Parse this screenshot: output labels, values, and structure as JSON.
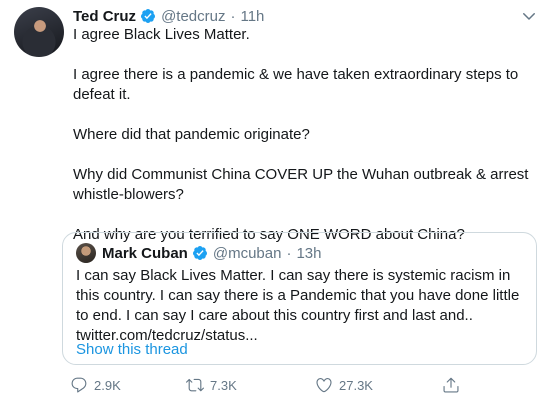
{
  "tweet": {
    "author_name": "Ted Cruz",
    "handle": "@tedcruz",
    "separator": "·",
    "time": "11h",
    "body": [
      "I agree Black Lives Matter.",
      "I agree there is a pandemic & we have taken extraordinary steps to defeat it.",
      "Where did that pandemic originate?",
      "Why did Communist China COVER UP the Wuhan outbreak & arrest whistle-blowers?",
      "And why are you terrified to say ONE WORD about China?"
    ]
  },
  "quoted_tweet": {
    "author_name": "Mark Cuban",
    "handle": "@mcuban",
    "separator": "·",
    "time": "13h",
    "text": "I can say Black Lives Matter. I can say there is systemic racism in this country. I can say there is a Pandemic that you have done little to end.  I can say I care about this country first and last and..",
    "link_text": "twitter.com/tedcruz/status...",
    "show_thread": "Show this thread"
  },
  "actions": {
    "reply_count": "2.9K",
    "retweet_count": "7.3K",
    "like_count": "27.3K"
  },
  "icons": {
    "verified": "verified-badge-icon",
    "more": "chevron-down-icon",
    "reply": "reply-icon",
    "retweet": "retweet-icon",
    "like": "heart-icon",
    "share": "share-icon"
  },
  "colors": {
    "verified": "#1da1f2",
    "link": "#1b95e0",
    "muted": "#657786",
    "border": "#cfd9de"
  }
}
